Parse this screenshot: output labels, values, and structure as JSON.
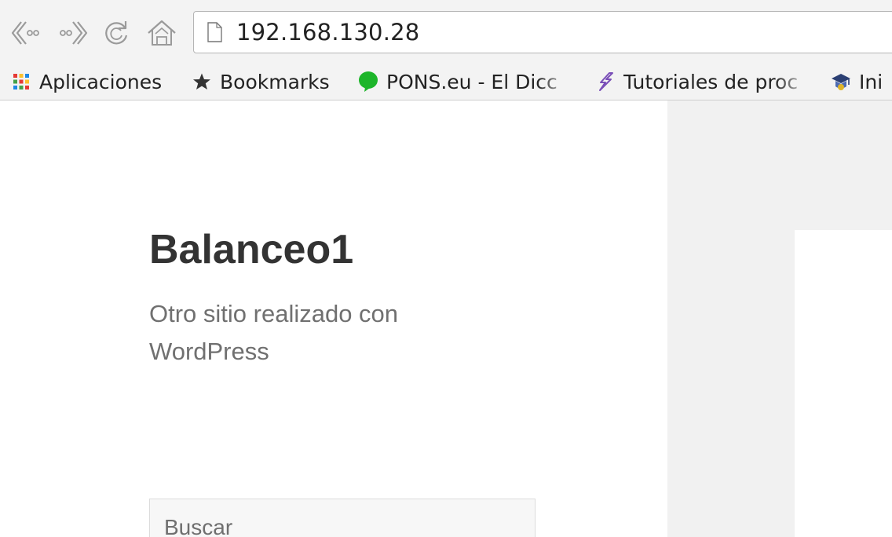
{
  "browser": {
    "address_bar": {
      "url": "192.168.130.28"
    },
    "nav": {
      "back_icon": "back-arrow-icon",
      "forward_icon": "forward-arrow-icon",
      "reload_icon": "reload-icon",
      "home_icon": "home-icon",
      "page_icon": "document-icon"
    },
    "bookmarks": [
      {
        "label": "Aplicaciones",
        "icon": "apps-grid-icon"
      },
      {
        "label": "Bookmarks",
        "icon": "star-icon"
      },
      {
        "label": "PONS.eu - El Dicc",
        "icon": "speech-bubble-icon",
        "icon_color": "#1db52a"
      },
      {
        "label": "Tutoriales de proc",
        "icon": "lightning-icon",
        "icon_color": "#7a4fb8"
      },
      {
        "label": "Ini",
        "icon": "graduation-cap-icon"
      }
    ]
  },
  "site": {
    "title": "Balanceo1",
    "description": "Otro sitio realizado con WordPress",
    "search": {
      "placeholder": "Buscar"
    }
  },
  "colors": {
    "toolbar_bg": "#f3f3f3",
    "sidebar_bg": "#f1f1f1",
    "title_color": "#333333",
    "description_color": "#707070"
  }
}
